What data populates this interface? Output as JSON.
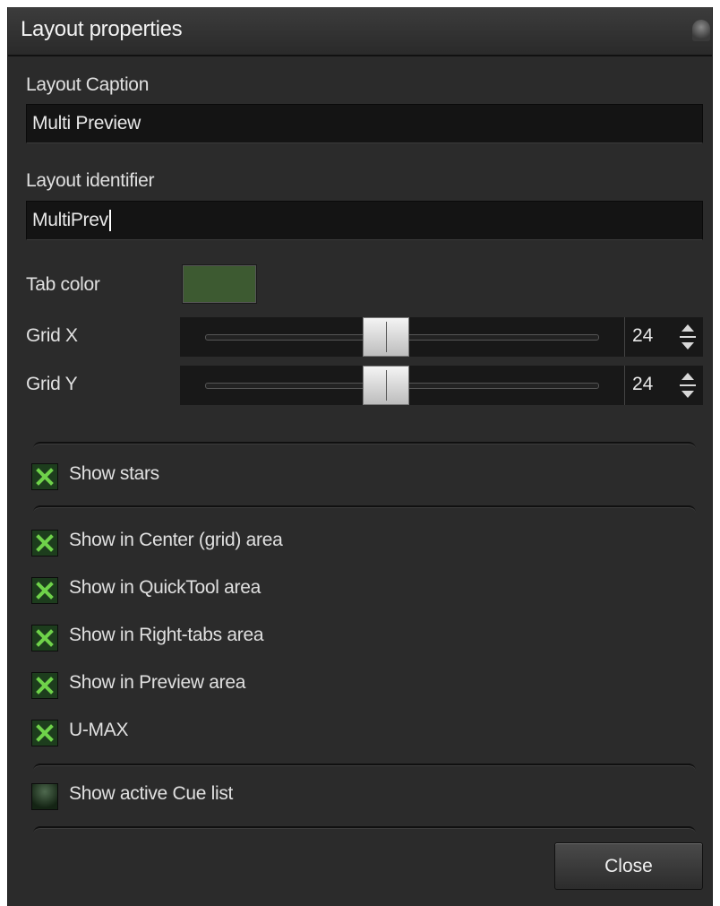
{
  "dialog": {
    "title": "Layout properties"
  },
  "layout_caption": {
    "label": "Layout Caption",
    "value": "Multi Preview"
  },
  "layout_identifier": {
    "label": "Layout identifier",
    "value": "MultiPrev"
  },
  "tab_color": {
    "label": "Tab color",
    "color": "#3d5a31"
  },
  "grid_x": {
    "label": "Grid X",
    "value": "24",
    "slider_fraction": 0.46
  },
  "grid_y": {
    "label": "Grid Y",
    "value": "24",
    "slider_fraction": 0.46
  },
  "checkboxes": [
    {
      "label": "Show stars",
      "checked": true
    },
    {
      "label": "Show in Center (grid) area",
      "checked": true
    },
    {
      "label": "Show in QuickTool area",
      "checked": true
    },
    {
      "label": "Show in Right-tabs area",
      "checked": true
    },
    {
      "label": "Show in Preview area",
      "checked": true
    },
    {
      "label": "U-MAX",
      "checked": true
    },
    {
      "label": "Show active Cue list",
      "checked": false
    }
  ],
  "buttons": {
    "close_label": "Close"
  },
  "colors": {
    "background": "#2b2b2b",
    "input_background": "#141414",
    "check_mark": "#6fd24a"
  }
}
